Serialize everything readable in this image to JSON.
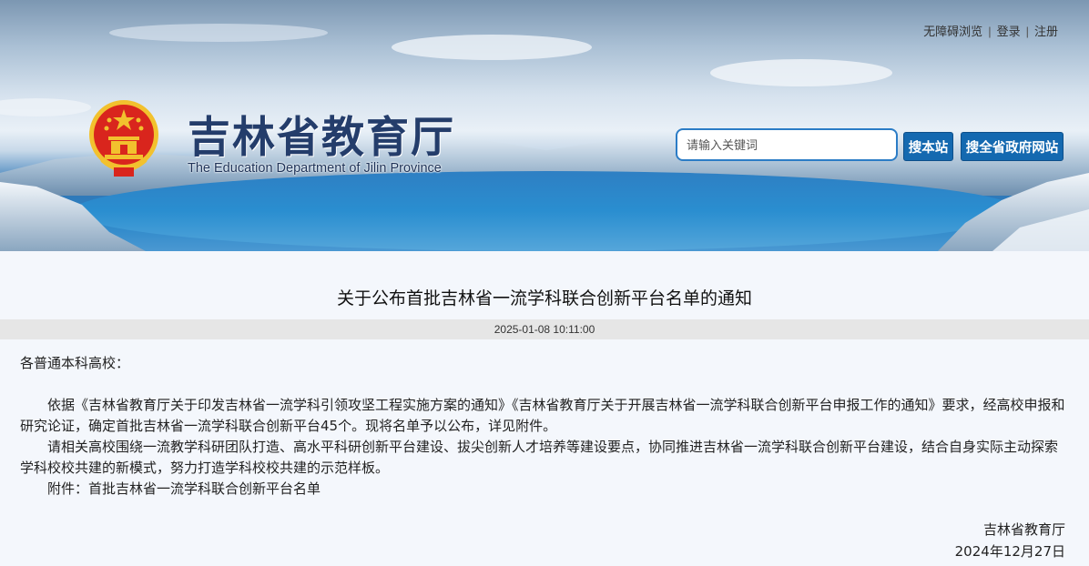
{
  "header": {
    "top_links": {
      "accessibility": "无障碍浏览",
      "login": "登录",
      "register": "注册",
      "separator": "|"
    },
    "site_title": "吉林省教育厅",
    "site_subtitle": "The Education Department of Jilin Province",
    "search": {
      "placeholder": "请输入关键词",
      "search_site_label": "搜本站",
      "search_gov_label": "搜全省政府网站"
    }
  },
  "article": {
    "title": "关于公布首批吉林省一流学科联合创新平台名单的通知",
    "datetime": "2025-01-08 10:11:00",
    "greeting": "各普通本科高校：",
    "paragraphs": [
      "依据《吉林省教育厅关于印发吉林省一流学科引领攻坚工程实施方案的通知》《吉林省教育厅关于开展吉林省一流学科联合创新平台申报工作的通知》要求，经高校申报和研究论证，确定首批吉林省一流学科联合创新平台45个。现将名单予以公布，详见附件。",
      "请相关高校围绕一流教学科研团队打造、高水平科研创新平台建设、拔尖创新人才培养等建设要点，协同推进吉林省一流学科联合创新平台建设，结合自身实际主动探索学科校校共建的新模式，努力打造学科校校共建的示范样板。",
      "附件：首批吉林省一流学科联合创新平台名单"
    ],
    "signature": {
      "org": "吉林省教育厅",
      "date": "2024年12月27日"
    }
  },
  "colors": {
    "button_blue": "#1469b0",
    "title_navy": "#243d6b",
    "emblem_red": "#d9251d",
    "emblem_gold": "#f2c12e"
  }
}
